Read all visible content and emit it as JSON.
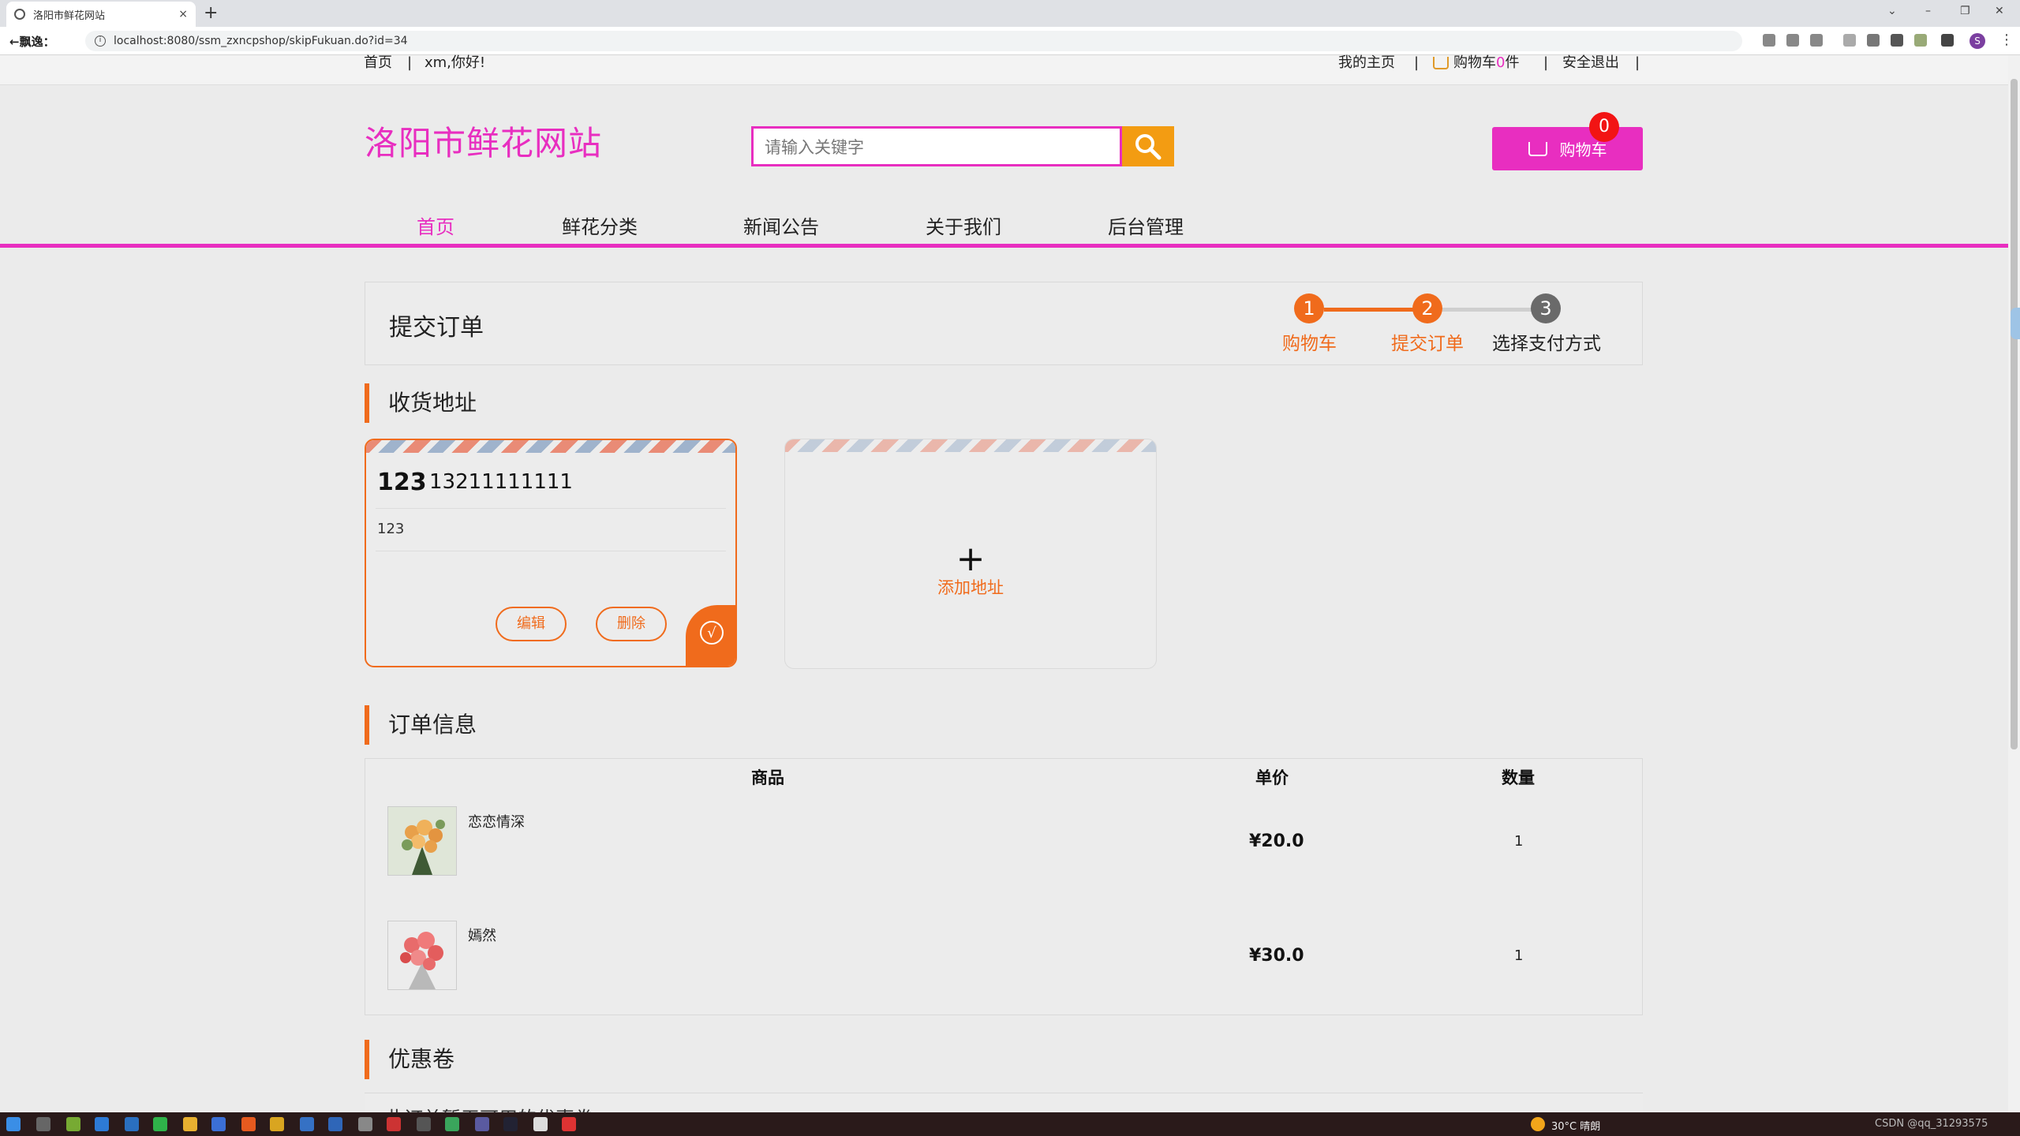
{
  "browser": {
    "tab_title": "洛阳市鲜花网站",
    "tab_close": "×",
    "new_tab": "+",
    "back_label": "←飘逸：",
    "url": "localhost:8080/ssm_zxncpshop/skipFukuan.do?id=34",
    "menu": "⋮",
    "profile_initial": "S"
  },
  "topbar": {
    "home": "首页",
    "sep": "|",
    "greeting": "xm,你好!",
    "my_home": "我的主页",
    "cart_prefix": "购物车",
    "cart_count": "0",
    "cart_suffix": "件",
    "logout": "安全退出"
  },
  "header": {
    "logo": "洛阳市鲜花网站",
    "search_placeholder": "请输入关键字",
    "cart_button": "购物车",
    "cart_badge": "0"
  },
  "mainnav": [
    "首页",
    "鲜花分类",
    "新闻公告",
    "关于我们",
    "后台管理"
  ],
  "steps": {
    "title": "提交订单",
    "items": [
      {
        "num": "1",
        "label": "购物车"
      },
      {
        "num": "2",
        "label": "提交订单"
      },
      {
        "num": "3",
        "label": "选择支付方式"
      }
    ]
  },
  "address": {
    "section_title": "收货地址",
    "name": "123",
    "phone": "13211111111",
    "detail": "123",
    "edit": "编辑",
    "delete": "删除",
    "check": "√",
    "add_plus": "+",
    "add_label": "添加地址"
  },
  "order": {
    "section_title": "订单信息",
    "headers": {
      "product": "商品",
      "price": "单价",
      "qty": "数量"
    },
    "rows": [
      {
        "name": "恋恋情深",
        "price": "¥20.0",
        "qty": "1"
      },
      {
        "name": "嫣然",
        "price": "¥30.0",
        "qty": "1"
      }
    ]
  },
  "coupon": {
    "section_title": "优惠卷",
    "peek_text": "此订单暂无可用的优惠卷"
  },
  "taskbar": {
    "weather": "30°C 晴朗",
    "watermark": "CSDN @qq_31293575"
  },
  "colors": {
    "brand": "#e82ec0",
    "accent": "#f06b1c",
    "search_btn": "#f39c12",
    "badge": "#f21414"
  }
}
